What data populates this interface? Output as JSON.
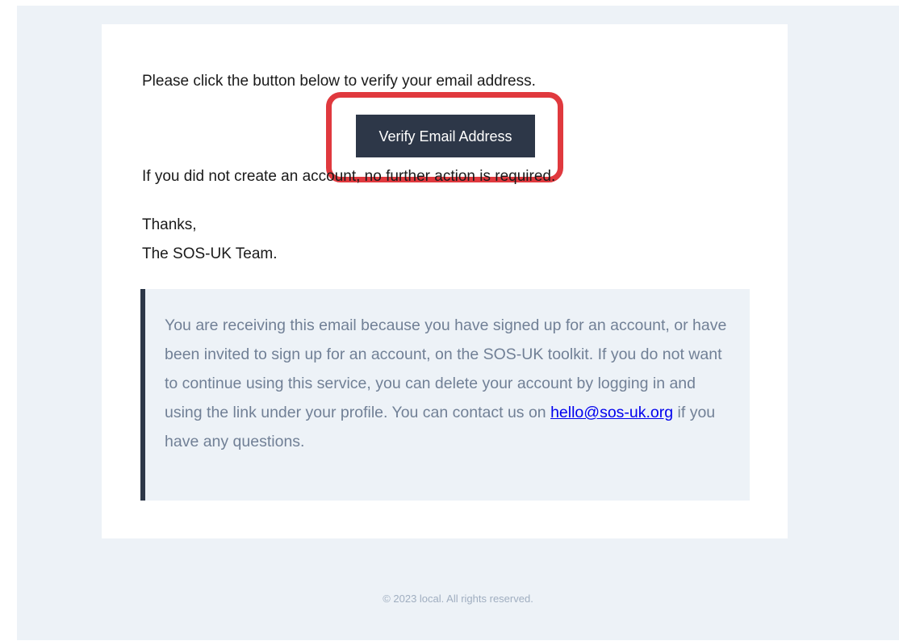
{
  "email": {
    "intro": "Please click the button below to verify your email address.",
    "verify_button_label": "Verify Email Address",
    "no_action": "If you did not create an account, no further action is required.",
    "thanks": "Thanks,",
    "team": "The SOS-UK Team.",
    "notice": {
      "text_before_link": "You are receiving this email because you have signed up for an account, or have been invited to sign up for an account, on the SOS-UK toolkit. If you do not want to continue using this service, you can delete your account by logging in and using the link under your profile. You can contact us on ",
      "link_text": "hello@sos-uk.org",
      "text_after_link": " if you have any questions."
    }
  },
  "footer": {
    "copyright": "© 2023 local. All rights reserved."
  },
  "colors": {
    "page_background": "#edf2f7",
    "button_background": "#2d3748",
    "highlight_border": "#e0393e",
    "notice_text": "#718096",
    "link": "#0000ee"
  }
}
